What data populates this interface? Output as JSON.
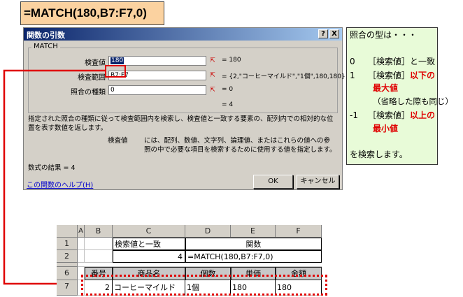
{
  "formula_banner": "=MATCH(180,B7:F7,0)",
  "dialog": {
    "title": "関数の引数",
    "help_btn": "?",
    "close_btn": "X",
    "group_label": "MATCH",
    "fields": [
      {
        "label": "検査値",
        "value": "180",
        "result": "= 180"
      },
      {
        "label": "検査範囲",
        "value": "B7:F7",
        "result": "= {2,\"コーヒーマイルド\",\"1個\",180,180}"
      },
      {
        "label": "照合の種類",
        "value": "0",
        "result": "= 0"
      }
    ],
    "overall_result": "= 4",
    "description": "指定された照合の種類に従って検査範囲内を検索し、検査値と一致する要素の、配列内での相対的な位置を表す数値を返します。",
    "arg_name": "検査値",
    "arg_help": "には、配列、数値、文字列、論理値、またはこれらの値への参照の中で必要な項目を検索するために使用する値を指定します。",
    "formula_result": "数式の結果 =   4",
    "help_link": "この関数のヘルプ(H)",
    "ok_label": "OK",
    "cancel_label": "キャンセル"
  },
  "match_info": {
    "heading": "照合の型は・・・",
    "line1_num": "0",
    "line1_text": "［検索値］と一致",
    "line2_num": "1",
    "line2_text": "［検索値］",
    "line2_red": "以下の",
    "line2b_red": "最大値",
    "line2c": "（省略した際も同じ）",
    "line3_num": "-1",
    "line3_text": "［検索値］",
    "line3_red": "以上の",
    "line3b_red": "最小値",
    "footer": "を検索します。"
  },
  "sheet": {
    "col_headers": [
      "A",
      "B",
      "C",
      "D",
      "E",
      "F"
    ],
    "row_headers": [
      "1",
      "2",
      "6",
      "7"
    ],
    "r1_c": "検索値と一致",
    "r1_d": "関数",
    "r2_c": "4",
    "r2_d": "=MATCH(180,B7:F7,0)",
    "r6": [
      "番号",
      "商品名",
      "個数",
      "単価",
      "金額"
    ],
    "r7": [
      "2",
      "コーヒーマイルド",
      "1個",
      "180",
      "180"
    ]
  },
  "colors": {
    "red": "#e00000",
    "banner": "#fbd2a0",
    "info_bg": "#e8fbd8",
    "titlebar": "#0a246a"
  }
}
